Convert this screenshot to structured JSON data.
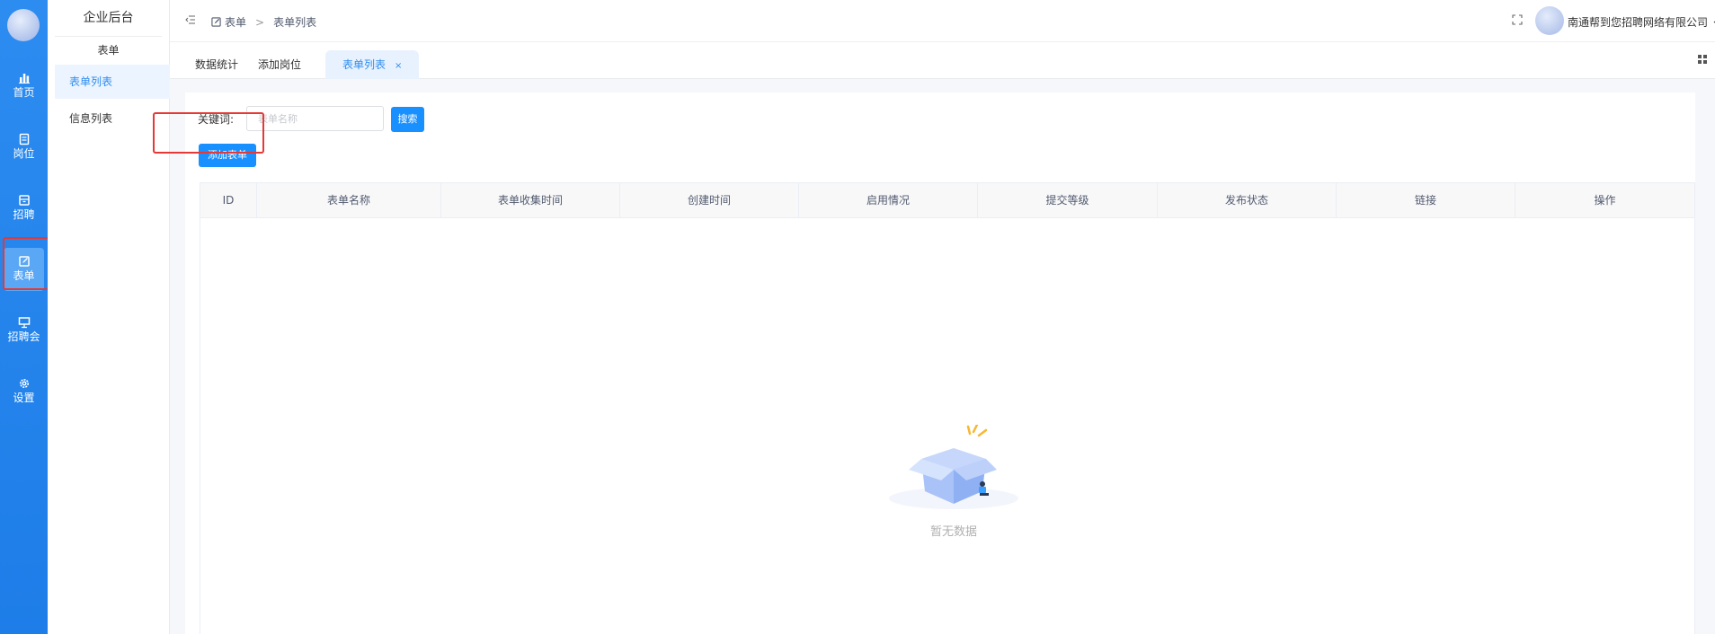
{
  "rail": {
    "items": [
      {
        "label": "首页",
        "icon": "bar-chart-icon"
      },
      {
        "label": "岗位",
        "icon": "document-icon"
      },
      {
        "label": "招聘",
        "icon": "inbox-icon"
      },
      {
        "label": "表单",
        "icon": "edit-form-icon"
      },
      {
        "label": "招聘会",
        "icon": "presentation-icon"
      },
      {
        "label": "设置",
        "icon": "gear-icon"
      }
    ],
    "active_index": 3
  },
  "subside": {
    "title": "企业后台",
    "group": "表单",
    "items": [
      {
        "label": "表单列表"
      },
      {
        "label": "信息列表"
      }
    ]
  },
  "header": {
    "breadcrumb": [
      "表单",
      "表单列表"
    ],
    "breadcrumb_sep": ">",
    "user": "南通帮到您招聘网络有限公司"
  },
  "tabs": [
    {
      "label": "数据统计"
    },
    {
      "label": "添加岗位"
    },
    {
      "label": "表单列表",
      "close": "×"
    }
  ],
  "filters": {
    "keyword_label": "关键词:",
    "keyword_placeholder": "表单名称",
    "keyword_value": "",
    "search_button": "搜索",
    "add_button": "添加表单"
  },
  "table": {
    "columns": [
      "ID",
      "表单名称",
      "表单收集时间",
      "创建时间",
      "启用情况",
      "提交等级",
      "发布状态",
      "链接",
      "操作"
    ],
    "rows": []
  },
  "empty_text": "暂无数据",
  "colors": {
    "primary": "#1890ff",
    "rail": "#2c8cf0",
    "highlight_box": "#e53935"
  }
}
